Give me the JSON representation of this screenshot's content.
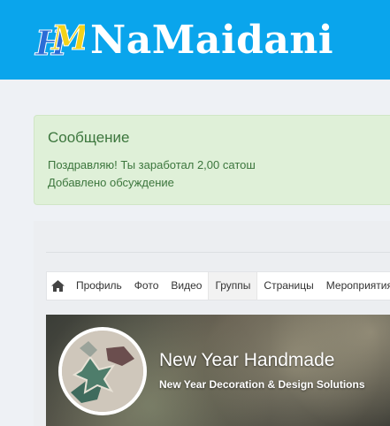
{
  "header": {
    "logo_mark": "HM",
    "site_name": "NaMaidani",
    "colors": {
      "background": "#0aa5ec",
      "logo_h": "#2b6cd6",
      "logo_m": "#f3d21a"
    }
  },
  "message": {
    "title": "Сообщение",
    "lines": [
      "Поздравляю! Ты заработал 2,00 сатош",
      "Добавлено обсуждение"
    ],
    "colors": {
      "background": "#dff0d8",
      "text": "#3c763d"
    }
  },
  "nav": {
    "home_icon": "home-icon",
    "items": [
      "Профиль",
      "Фото",
      "Видео",
      "Группы",
      "Страницы",
      "Мероприятия"
    ],
    "active": "Группы"
  },
  "group": {
    "title": "New Year Handmade",
    "subtitle": "New Year Decoration & Design Solutions"
  }
}
